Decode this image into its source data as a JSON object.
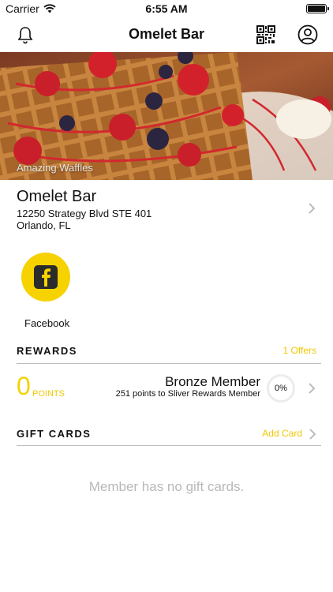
{
  "status_bar": {
    "carrier": "Carrier",
    "time": "6:55 AM"
  },
  "nav": {
    "title": "Omelet Bar",
    "left_icon": "bell-icon",
    "right_icons": [
      "qr-code-icon",
      "profile-icon"
    ]
  },
  "hero": {
    "caption": "Amazing Waffles"
  },
  "location": {
    "name": "Omelet Bar",
    "address_line1": "12250 Strategy Blvd STE 401",
    "address_line2": "Orlando, FL"
  },
  "social": [
    {
      "label": "Facebook",
      "icon": "facebook-icon"
    }
  ],
  "rewards": {
    "section_title": "REWARDS",
    "offers_link": "1 Offers",
    "points_value": "0",
    "points_label": "POINTS",
    "member_level": "Bronze Member",
    "next_level_text": "251 points to Sliver Rewards Member",
    "progress_text": "0%",
    "progress": 0
  },
  "gift_cards": {
    "section_title": "GIFT CARDS",
    "add_link": "Add Card",
    "empty_message": "Member has no gift cards."
  },
  "colors": {
    "accent": "#f5d200",
    "divider": "#bdbdbd",
    "muted_text": "#b8b8b8"
  }
}
